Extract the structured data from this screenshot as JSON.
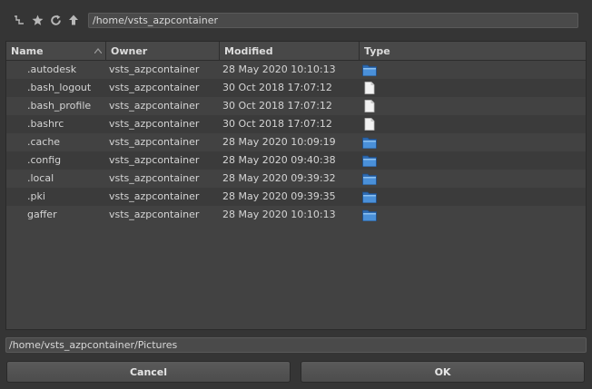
{
  "toolbar": {
    "icons": [
      "collapse-icon",
      "bookmark-star-icon",
      "refresh-icon",
      "up-arrow-icon"
    ],
    "path": "/home/vsts_azpcontainer"
  },
  "table": {
    "columns": [
      "Name",
      "Owner",
      "Modified",
      "Type"
    ],
    "rows": [
      {
        "name": ".autodesk",
        "owner": "vsts_azpcontainer",
        "modified": "28 May 2020 10:10:13",
        "type": "folder"
      },
      {
        "name": ".bash_logout",
        "owner": "vsts_azpcontainer",
        "modified": "30 Oct 2018 17:07:12",
        "type": "file"
      },
      {
        "name": ".bash_profile",
        "owner": "vsts_azpcontainer",
        "modified": "30 Oct 2018 17:07:12",
        "type": "file"
      },
      {
        "name": ".bashrc",
        "owner": "vsts_azpcontainer",
        "modified": "30 Oct 2018 17:07:12",
        "type": "file"
      },
      {
        "name": ".cache",
        "owner": "vsts_azpcontainer",
        "modified": "28 May 2020 10:09:19",
        "type": "folder"
      },
      {
        "name": ".config",
        "owner": "vsts_azpcontainer",
        "modified": "28 May 2020 09:40:38",
        "type": "folder"
      },
      {
        "name": ".local",
        "owner": "vsts_azpcontainer",
        "modified": "28 May 2020 09:39:32",
        "type": "folder"
      },
      {
        "name": ".pki",
        "owner": "vsts_azpcontainer",
        "modified": "28 May 2020 09:39:35",
        "type": "folder"
      },
      {
        "name": "gaffer",
        "owner": "vsts_azpcontainer",
        "modified": "28 May 2020 10:10:13",
        "type": "folder"
      }
    ]
  },
  "selection_path": "/home/vsts_azpcontainer/Pictures",
  "buttons": {
    "cancel": "Cancel",
    "ok": "OK"
  },
  "colors": {
    "folder": "#4a90d9",
    "file": "#f2f2f2",
    "background": "#353535"
  }
}
